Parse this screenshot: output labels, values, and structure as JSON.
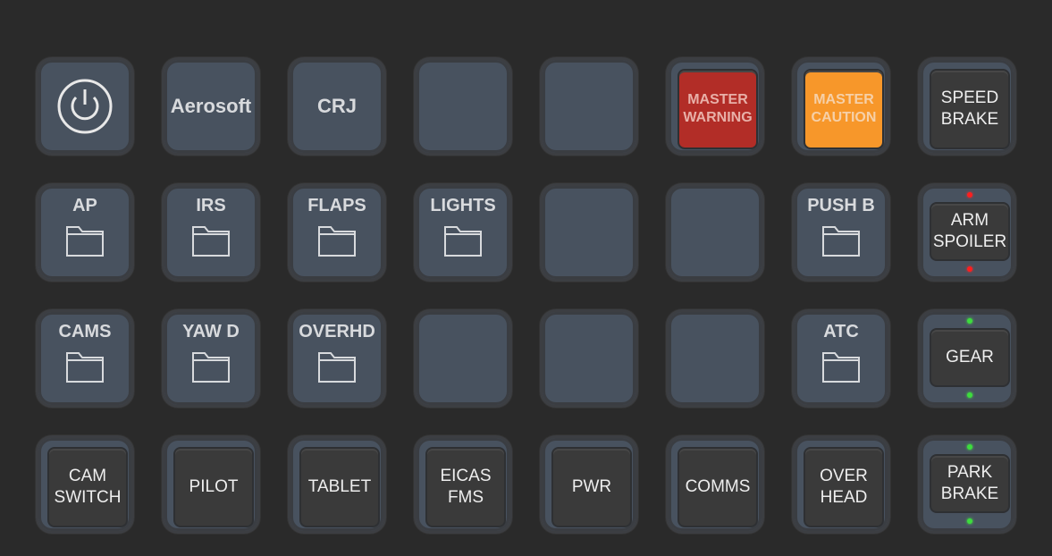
{
  "colors": {
    "background": "#2a2a2a",
    "key": "#48525f",
    "warning": "#b22d27",
    "caution": "#f7972a",
    "led_red": "#ff1e1e",
    "led_green": "#3ddc3d"
  },
  "rows": [
    [
      {
        "type": "icon",
        "icon": "power-icon"
      },
      {
        "type": "text",
        "label": "Aerosoft"
      },
      {
        "type": "text",
        "label": "CRJ"
      },
      {
        "type": "empty"
      },
      {
        "type": "empty"
      },
      {
        "type": "annunciator",
        "label": "MASTER WARNING",
        "style": "red"
      },
      {
        "type": "annunciator",
        "label": "MASTER CAUTION",
        "style": "orange"
      },
      {
        "type": "button",
        "label": "SPEED BRAKE"
      }
    ],
    [
      {
        "type": "folder",
        "label": "AP",
        "icon": "folder-icon"
      },
      {
        "type": "folder",
        "label": "IRS",
        "icon": "folder-icon"
      },
      {
        "type": "folder",
        "label": "FLAPS",
        "icon": "folder-icon"
      },
      {
        "type": "folder",
        "label": "LIGHTS",
        "icon": "folder-icon"
      },
      {
        "type": "empty"
      },
      {
        "type": "empty"
      },
      {
        "type": "folder",
        "label": "PUSH B",
        "icon": "folder-icon"
      },
      {
        "type": "lightbutton",
        "label": "ARM SPOILER",
        "led": "red"
      }
    ],
    [
      {
        "type": "folder",
        "label": "CAMS",
        "icon": "folder-icon"
      },
      {
        "type": "folder",
        "label": "YAW D",
        "icon": "folder-icon"
      },
      {
        "type": "folder",
        "label": "OVERHD",
        "icon": "folder-icon"
      },
      {
        "type": "empty"
      },
      {
        "type": "empty"
      },
      {
        "type": "empty"
      },
      {
        "type": "folder",
        "label": "ATC",
        "icon": "folder-icon"
      },
      {
        "type": "lightbutton",
        "label": "GEAR",
        "led": "green"
      }
    ],
    [
      {
        "type": "button",
        "label": "CAM SWITCH"
      },
      {
        "type": "button",
        "label": "PILOT"
      },
      {
        "type": "button",
        "label": "TABLET"
      },
      {
        "type": "button",
        "label": "EICAS FMS"
      },
      {
        "type": "button",
        "label": "PWR"
      },
      {
        "type": "button",
        "label": "COMMS"
      },
      {
        "type": "button",
        "label": "OVER HEAD"
      },
      {
        "type": "lightbutton",
        "label": "PARK BRAKE",
        "led": "green"
      }
    ]
  ]
}
